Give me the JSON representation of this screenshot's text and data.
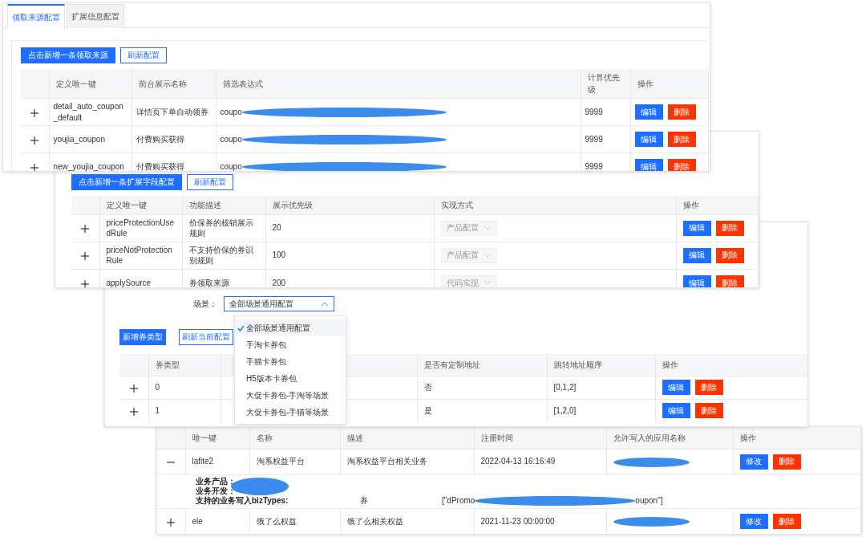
{
  "panels": [
    {
      "tabs": [
        {
          "label": "领取来源配置",
          "selected": true
        },
        {
          "label": "扩展信息配置",
          "selected": false
        }
      ],
      "buttons": [
        {
          "label": "点击新增一条领取来源",
          "kind": "primary"
        },
        {
          "label": "刷新配置",
          "kind": "outline"
        }
      ],
      "table": {
        "columns": [
          "定义唯一键",
          "前台展示名称",
          "筛选表达式",
          "计算优先级",
          "操作"
        ],
        "rows": [
          {
            "expanded": false,
            "cells": [
              {
                "kind": "text",
                "text": "detail_auto_coupon_default"
              },
              {
                "kind": "text",
                "text": "详情页下单自动领券"
              },
              {
                "kind": "redacted",
                "text": "coupo"
              },
              {
                "kind": "text",
                "text": "9999"
              }
            ],
            "actions": [
              {
                "label": "编辑",
                "kind": "primary"
              },
              {
                "label": "删除",
                "kind": "danger"
              }
            ]
          },
          {
            "expanded": false,
            "cells": [
              {
                "kind": "text",
                "text": "youjia_coupon"
              },
              {
                "kind": "text",
                "text": "付费购买获得"
              },
              {
                "kind": "redacted",
                "text": "coupo"
              },
              {
                "kind": "text",
                "text": "9999"
              }
            ],
            "actions": [
              {
                "label": "编辑",
                "kind": "primary"
              },
              {
                "label": "删除",
                "kind": "danger"
              }
            ]
          },
          {
            "expanded": false,
            "cells": [
              {
                "kind": "text",
                "text": "new_youjia_coupon"
              },
              {
                "kind": "text",
                "text": "付费购买获得"
              },
              {
                "kind": "redacted",
                "text": "coupo"
              },
              {
                "kind": "text",
                "text": "9999"
              }
            ],
            "actions": [
              {
                "label": "编辑",
                "kind": "primary"
              },
              {
                "label": "删除",
                "kind": "danger"
              }
            ]
          }
        ]
      }
    },
    {
      "buttons": [
        {
          "label": "点击新增一条扩展字段配置",
          "kind": "primary"
        },
        {
          "label": "刷新配置",
          "kind": "outline"
        }
      ],
      "table": {
        "columns": [
          "定义唯一键",
          "功能描述",
          "展示优先级",
          "实现方式",
          "操作"
        ],
        "rows": [
          {
            "expanded": false,
            "cells": [
              {
                "kind": "text",
                "text": "priceProtectionUsedRule"
              },
              {
                "kind": "text",
                "text": "价保券的核销展示规则"
              },
              {
                "kind": "text",
                "text": "20"
              },
              {
                "kind": "select",
                "value": "产品配置",
                "disabled": true
              }
            ],
            "actions": [
              {
                "label": "编辑",
                "kind": "primary"
              },
              {
                "label": "删除",
                "kind": "danger"
              }
            ]
          },
          {
            "expanded": false,
            "cells": [
              {
                "kind": "text",
                "text": "priceNotProtectionRule"
              },
              {
                "kind": "text",
                "text": "不支持价保的券识别规则"
              },
              {
                "kind": "text",
                "text": "100"
              },
              {
                "kind": "select",
                "value": "产品配置",
                "disabled": true
              }
            ],
            "actions": [
              {
                "label": "编辑",
                "kind": "primary"
              },
              {
                "label": "删除",
                "kind": "danger"
              }
            ]
          },
          {
            "expanded": false,
            "cells": [
              {
                "kind": "text",
                "text": "applySource"
              },
              {
                "kind": "text",
                "text": "券领取来源"
              },
              {
                "kind": "text",
                "text": "200"
              },
              {
                "kind": "select",
                "value": "代码实现",
                "disabled": true
              }
            ],
            "actions": [
              {
                "label": "编辑",
                "kind": "primary"
              },
              {
                "label": "删除",
                "kind": "danger"
              }
            ]
          }
        ]
      }
    },
    {
      "filter": {
        "label": "场景：",
        "value": "全部场景通用配置",
        "open": true,
        "options": [
          {
            "label": "全部场景通用配置",
            "selected": true
          },
          {
            "label": "手淘卡券包",
            "selected": false
          },
          {
            "label": "手猫卡券包",
            "selected": false
          },
          {
            "label": "H5版本卡券包",
            "selected": false
          },
          {
            "label": "大促卡券包-手淘等场景",
            "selected": false
          },
          {
            "label": "大促卡券包-手猫等场景",
            "selected": false
          }
        ]
      },
      "buttons": [
        {
          "label": "新增券类型",
          "kind": "primary"
        },
        {
          "label": "刷新当前配置",
          "kind": "outline"
        }
      ],
      "table": {
        "columns": [
          "券类型",
          "",
          "是否有定制地址",
          "跳转地址顺序",
          "操作"
        ],
        "rows": [
          {
            "expanded": false,
            "cells": [
              {
                "kind": "text",
                "text": "0"
              },
              {
                "kind": "hidden"
              },
              {
                "kind": "text",
                "text": "否"
              },
              {
                "kind": "text",
                "text": "[0,1,2]"
              }
            ],
            "actions": [
              {
                "label": "编辑",
                "kind": "primary"
              },
              {
                "label": "删除",
                "kind": "danger"
              }
            ]
          },
          {
            "expanded": false,
            "cells": [
              {
                "kind": "text",
                "text": "1"
              },
              {
                "kind": "hidden"
              },
              {
                "kind": "text",
                "text": "是"
              },
              {
                "kind": "text",
                "text": "[1,2,0]"
              }
            ],
            "actions": [
              {
                "label": "编辑",
                "kind": "primary"
              },
              {
                "label": "删除",
                "kind": "danger"
              }
            ]
          }
        ]
      }
    },
    {
      "table": {
        "columns": [
          "唯一键",
          "名称",
          "描述",
          "注册时间",
          "允许写入的应用名称",
          "操作"
        ],
        "rows": [
          {
            "expanded": true,
            "cells": [
              {
                "kind": "text",
                "text": "lafite2"
              },
              {
                "kind": "text",
                "text": "淘系权益平台"
              },
              {
                "kind": "text",
                "text": "淘系权益平台相关业务"
              },
              {
                "kind": "text",
                "text": "2022-04-13 16:16:49"
              },
              {
                "kind": "blob"
              }
            ],
            "actions": [
              {
                "label": "修改",
                "kind": "primary"
              },
              {
                "label": "删除",
                "kind": "danger"
              }
            ],
            "detail": {
              "lines": [
                "业务产品：",
                "业务开发："
              ],
              "biz_label": "支持的业务写入bizTypes:",
              "biz_type": "券",
              "value_start": "[\"dPromo",
              "value_end": "oupon\"]"
            }
          },
          {
            "expanded": false,
            "cells": [
              {
                "kind": "text",
                "text": "ele"
              },
              {
                "kind": "text",
                "text": "饿了么权益"
              },
              {
                "kind": "text",
                "text": "饿了么相关权益"
              },
              {
                "kind": "text",
                "text": "2021-11-23 00:00:00"
              },
              {
                "kind": "blob"
              }
            ],
            "actions": [
              {
                "label": "修改",
                "kind": "primary"
              },
              {
                "label": "删除",
                "kind": "danger"
              }
            ]
          }
        ]
      }
    }
  ]
}
